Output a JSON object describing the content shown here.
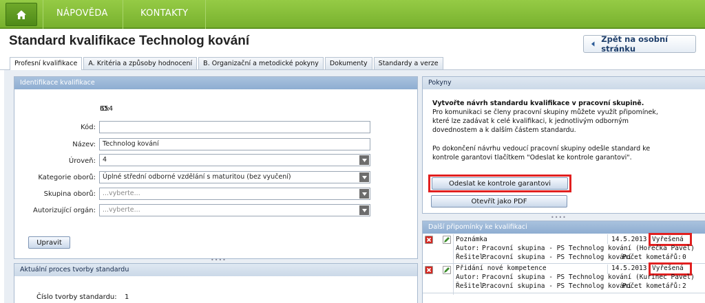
{
  "nav": {
    "items": [
      {
        "label": "NÁPOVĚDA"
      },
      {
        "label": "KONTAKTY"
      }
    ]
  },
  "header": {
    "title": "Standard kvalifikace Technolog kování",
    "back_label": "Zpět na osobní stránku"
  },
  "tabs": [
    {
      "label": "Profesní kvalifikace",
      "active": true
    },
    {
      "label": "A. Kritéria a způsoby hodnocení"
    },
    {
      "label": "B. Organizační a metodické pokyny"
    },
    {
      "label": "Dokumenty"
    },
    {
      "label": "Standardy a verze"
    }
  ],
  "identification": {
    "title": "Identifikace kvalifikace",
    "id_label": "ID:",
    "id_value": "654",
    "kod_label": "Kód:",
    "kod_value": "",
    "nazev_label": "Název:",
    "nazev_value": "Technolog kování",
    "uroven_label": "Úroveň:",
    "uroven_value": "4",
    "kategorie_label": "Kategorie oborů:",
    "kategorie_value": "Úplné střední odborné vzdělání s maturitou (bez vyučení)",
    "skupina_label": "Skupina oborů:",
    "skupina_placeholder": "...vyberte...",
    "autorizujici_label": "Autorizující orgán:",
    "autorizujici_placeholder": "...vyberte...",
    "edit_label": "Upravit"
  },
  "process": {
    "title": "Aktuální proces tvorby standardu",
    "number_label": "Číslo tvorby standardu:",
    "number_value": "1"
  },
  "instructions": {
    "title": "Pokyny",
    "heading": "Vytvořte návrh standardu kvalifikace v pracovní skupině.",
    "p1_l1": "Pro komunikaci se členy pracovní skupiny můžete využít připomínek,",
    "p1_l2": "které lze zadávat k celé kvalifikaci, k jednotlivým odborným",
    "p1_l3": "dovednostem a k dalším částem standardu.",
    "p2_l1": "Po dokončení návrhu vedoucí pracovní skupiny odešle standard ke",
    "p2_l2": "kontrole garantovi tlačítkem \"Odeslat ke kontrole garantovi\".",
    "send_label": "Odeslat ke kontrole garantovi",
    "pdf_label": "Otevřít jako PDF"
  },
  "comments": {
    "title": "Další připomínky ke kvalifikaci",
    "items": [
      {
        "title": "Poznámka",
        "date": "14.5.2013",
        "status": "Vyřešená",
        "author_label": "Autor:",
        "author": "Pracovní skupina - PS Technolog kování (Horečka Pavel)",
        "solver_label": "Řešitel:",
        "solver": "Pracovní skupina - PS Technolog kování",
        "count_label": "Počet kometářů:",
        "count": "0"
      },
      {
        "title": "Přidání nové kompetence",
        "date": "14.5.2013",
        "status": "Vyřešená",
        "author_label": "Autor:",
        "author": "Pracovní skupina - PS Technolog kování (Kurinec Pavel)",
        "solver_label": "Řešitel:",
        "solver": "Pracovní skupina - PS Technolog kování",
        "count_label": "Počet kometářů:",
        "count": "2"
      }
    ]
  },
  "colors": {
    "nav_green": "#78b12e",
    "panel_header": "#8eadd1",
    "highlight_red": "#e11f1f"
  }
}
